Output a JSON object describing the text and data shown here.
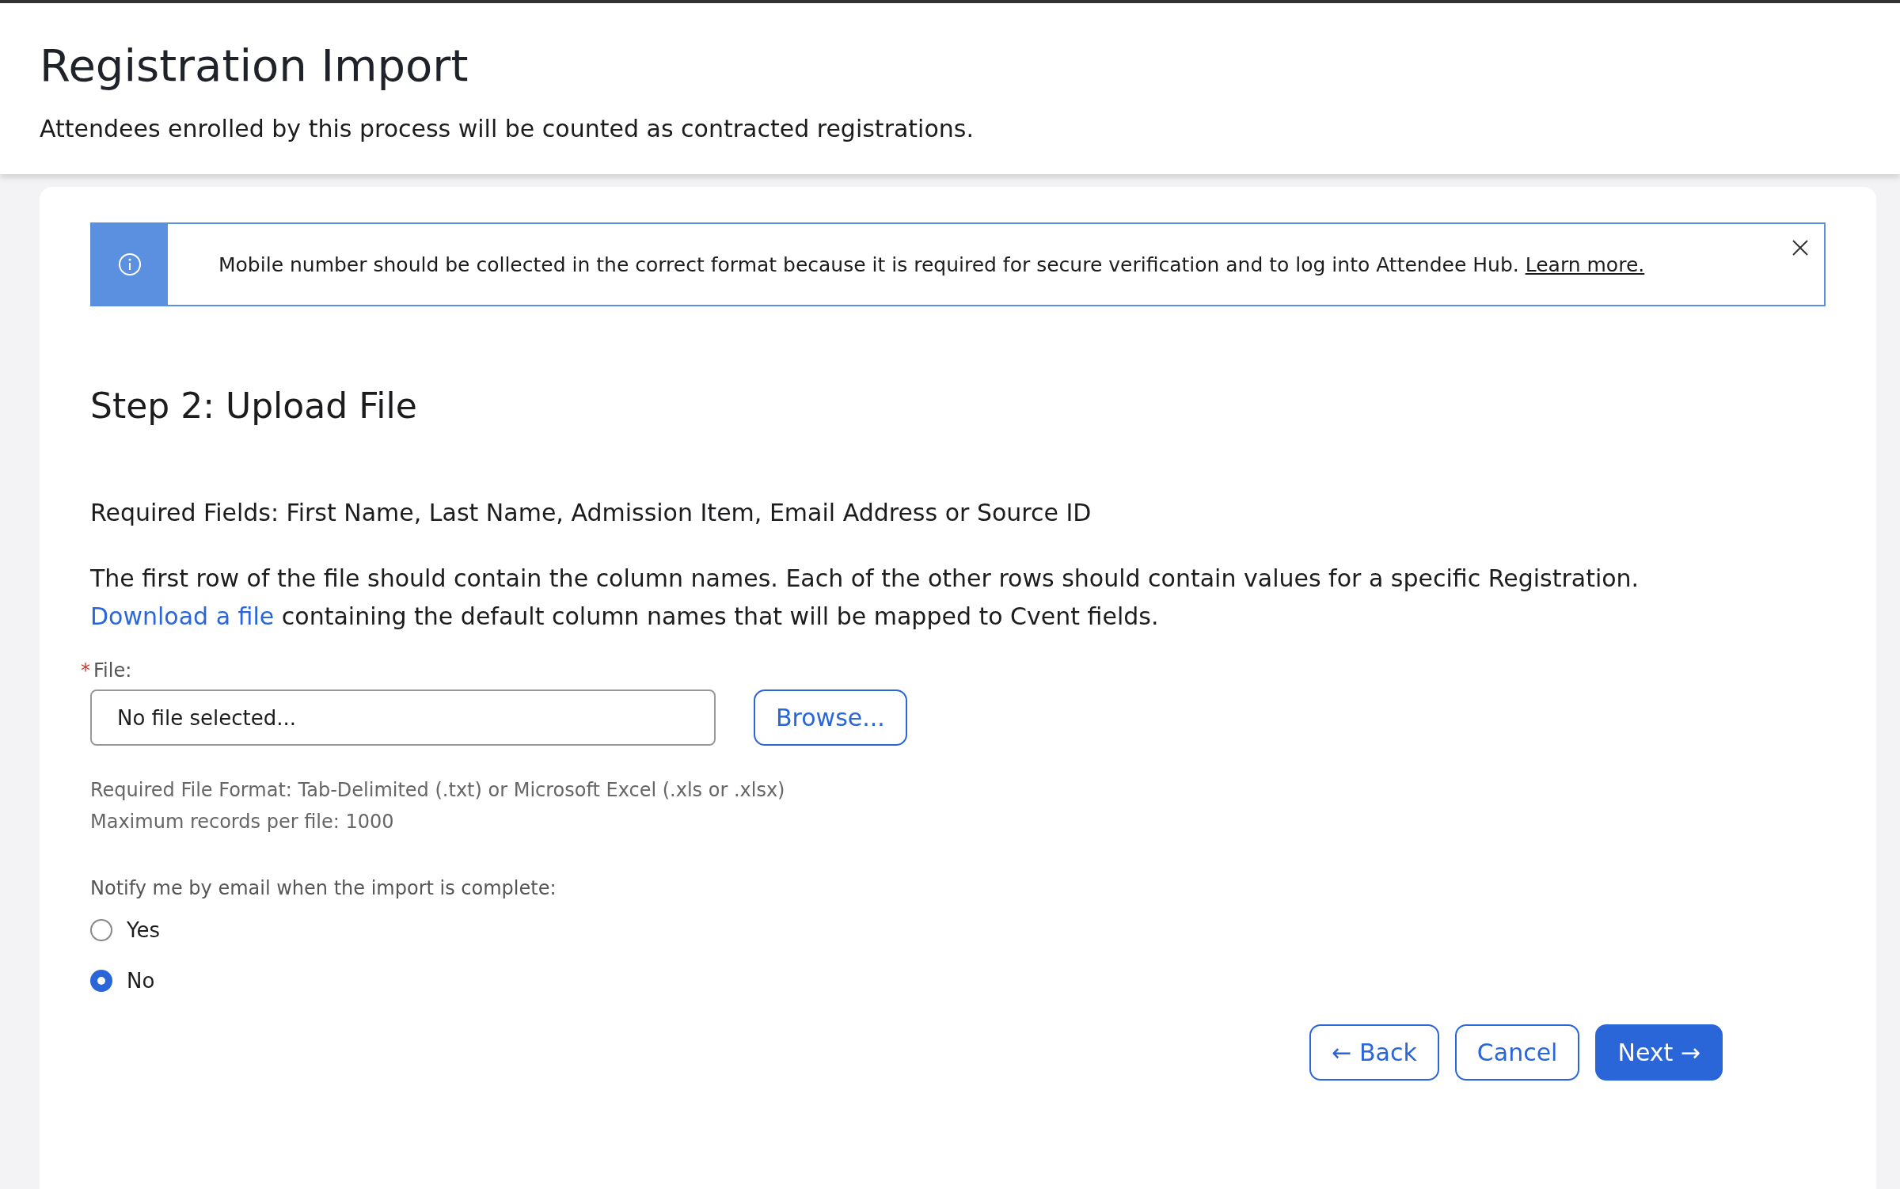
{
  "header": {
    "title": "Registration Import",
    "subtitle": "Attendees enrolled by this process will be counted as contracted registrations."
  },
  "banner": {
    "message": "Mobile number should be collected in the correct format because it is required for secure verification and to log into Attendee Hub.",
    "link": "Learn more."
  },
  "step_title": "Step 2: Upload File",
  "required_fields": "Required Fields: First Name, Last Name, Admission Item, Email Address or Source ID",
  "instructions": "The first row of the file should contain the column names. Each of the other rows should contain values for a specific Registration.",
  "download": {
    "link": "Download a file",
    "text": "containing the default column names that will be mapped to Cvent fields."
  },
  "file_field": {
    "required_mark": "*",
    "label": "File:",
    "value": "No file selected...",
    "browse": "Browse..."
  },
  "help": [
    "Required File Format: Tab-Delimited (.txt) or Microsoft Excel (.xls or .xlsx)",
    "Maximum records per file: 1000"
  ],
  "notify": {
    "label": "Notify me by email when the import is complete:",
    "options": [
      {
        "label": "Yes",
        "selected": false
      },
      {
        "label": "No",
        "selected": true
      }
    ]
  },
  "buttons": [
    {
      "label": "← Back",
      "kind": "outline"
    },
    {
      "label": "Cancel",
      "kind": "outline"
    },
    {
      "label": "Next →",
      "kind": "primary"
    }
  ]
}
